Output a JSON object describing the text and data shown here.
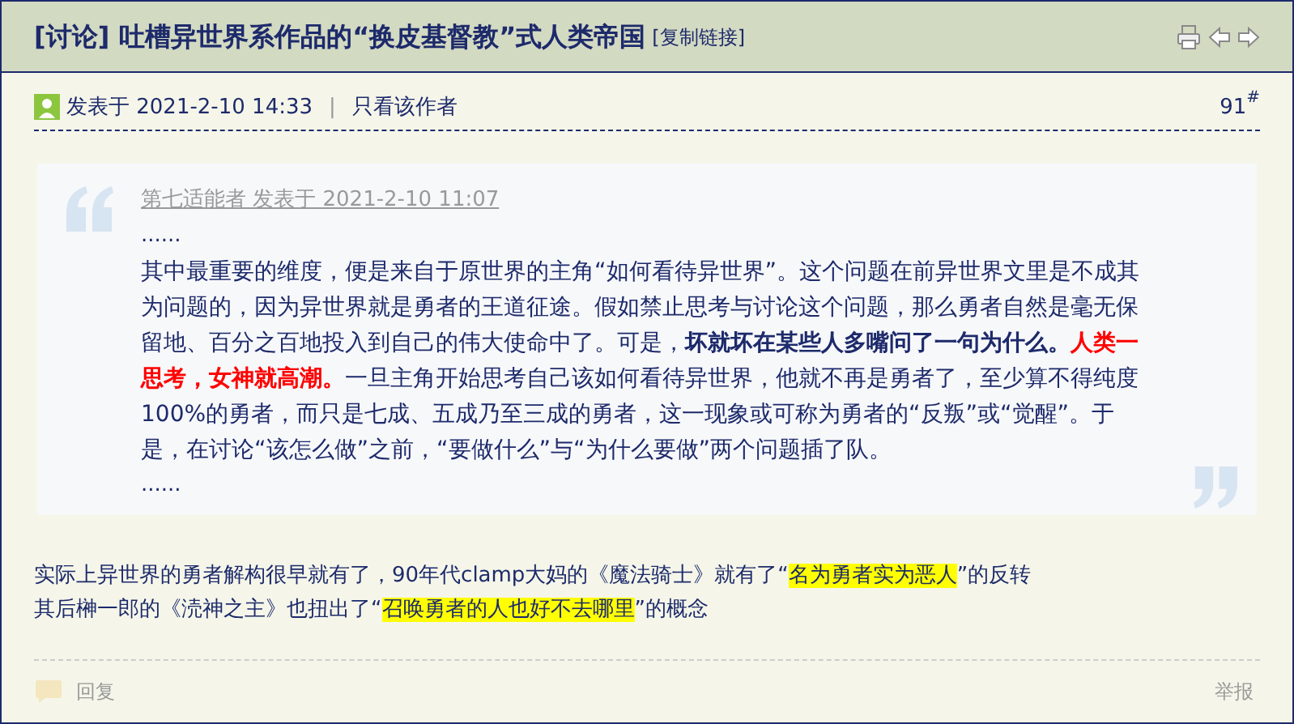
{
  "thread": {
    "tag": "[讨论]",
    "title": "吐槽异世界系作品的“换皮基督教”式人类帝国",
    "copy_link": "[复制链接]"
  },
  "post": {
    "posted": "发表于 2021-2-10 14:33",
    "separator": "|",
    "only_author": "只看该作者",
    "floor": "91",
    "floor_mark": "#"
  },
  "quote": {
    "author_line": "第七适能者 发表于 2021-2-10 11:07",
    "ellipsis_top": "......",
    "segments": [
      {
        "kind": "plain",
        "text": "其中最重要的维度，便是来自于原世界的主角“如何看待异世界”。这个问题在前异世界文里是不成其为问题的，因为异世界就是勇者的王道征途。假如禁止思考与讨论这个问题，那么勇者自然是毫无保留地、百分之百地投入到自己的伟大使命中了。可是，"
      },
      {
        "kind": "bold",
        "text": "坏就坏在某些人多嘴问了一句为什么。"
      },
      {
        "kind": "red",
        "text": "人类一思考，女神就高潮。"
      },
      {
        "kind": "plain",
        "text": "一旦主角开始思考自己该如何看待异世界，他就不再是勇者了，至少算不得纯度100%的勇者，而只是七成、五成乃至三成的勇者，这一现象或可称为勇者的“反叛”或“觉醒”。于是，在讨论“该怎么做”之前，“要做什么”与“为什么要做”两个问题插了队。"
      }
    ],
    "ellipsis_bottom": "......"
  },
  "reply_lines": [
    [
      {
        "text": "实际上异世界的勇者解构很早就有了，90年代clamp大妈的《魔法骑士》就有了“",
        "highlight": false
      },
      {
        "text": "名为勇者实为恶人",
        "highlight": true
      },
      {
        "text": "”的反转",
        "highlight": false
      }
    ],
    [
      {
        "text": "其后榊一郎的《涜神之主》也扭出了“",
        "highlight": false
      },
      {
        "text": "召唤勇者的人也好不去哪里",
        "highlight": true
      },
      {
        "text": "”的概念",
        "highlight": false
      }
    ]
  ],
  "footer": {
    "reply": "回复",
    "report": "举报"
  }
}
